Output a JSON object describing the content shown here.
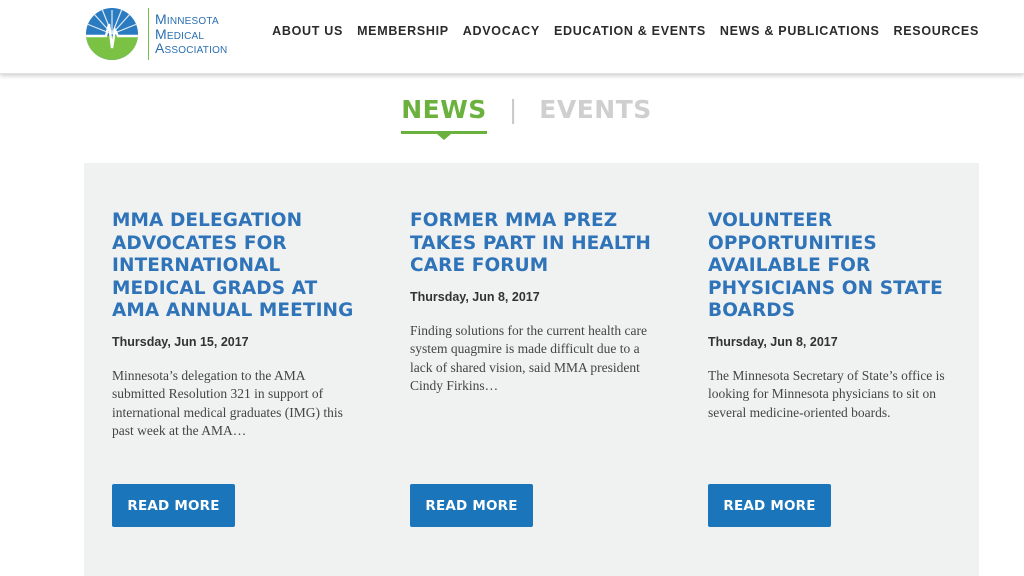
{
  "brand": {
    "line1": "Minnesota",
    "line2": "Medical",
    "line3": "Association",
    "colors": {
      "blue": "#2a6fb0",
      "green": "#7bc143"
    },
    "logo_icon": "heartbeat-globe-icon"
  },
  "nav": {
    "items": [
      {
        "label": "ABOUT US"
      },
      {
        "label": "MEMBERSHIP"
      },
      {
        "label": "ADVOCACY"
      },
      {
        "label": "EDUCATION & EVENTS"
      },
      {
        "label": "NEWS & PUBLICATIONS"
      },
      {
        "label": "RESOURCES"
      }
    ]
  },
  "tabs": {
    "news": "NEWS",
    "separator": "|",
    "events": "EVENTS",
    "active": "NEWS",
    "active_color": "#6ab23d"
  },
  "articles": [
    {
      "title": "MMA DELEGATION ADVOCATES FOR INTERNATIONAL MEDICAL GRADS AT AMA ANNUAL MEETING",
      "date": "Thursday, Jun 15, 2017",
      "excerpt": "Minnesota’s delegation to the AMA submitted Resolution 321 in support of international medical graduates (IMG) this past week at the AMA…",
      "button": "READ MORE"
    },
    {
      "title": "FORMER MMA PREZ TAKES PART IN HEALTH CARE FORUM",
      "date": "Thursday, Jun 8, 2017",
      "excerpt": "Finding solutions for the current health care system quagmire is made difficult due to a lack of shared vision, said MMA president Cindy Firkins…",
      "button": "READ MORE"
    },
    {
      "title": "VOLUNTEER OPPORTUNITIES AVAILABLE FOR PHYSICIANS ON STATE BOARDS",
      "date": "Thursday, Jun 8, 2017",
      "excerpt": "The Minnesota Secretary of State’s office is looking for Minnesota physicians to sit on several medicine-oriented boards.",
      "button": "READ MORE"
    }
  ]
}
